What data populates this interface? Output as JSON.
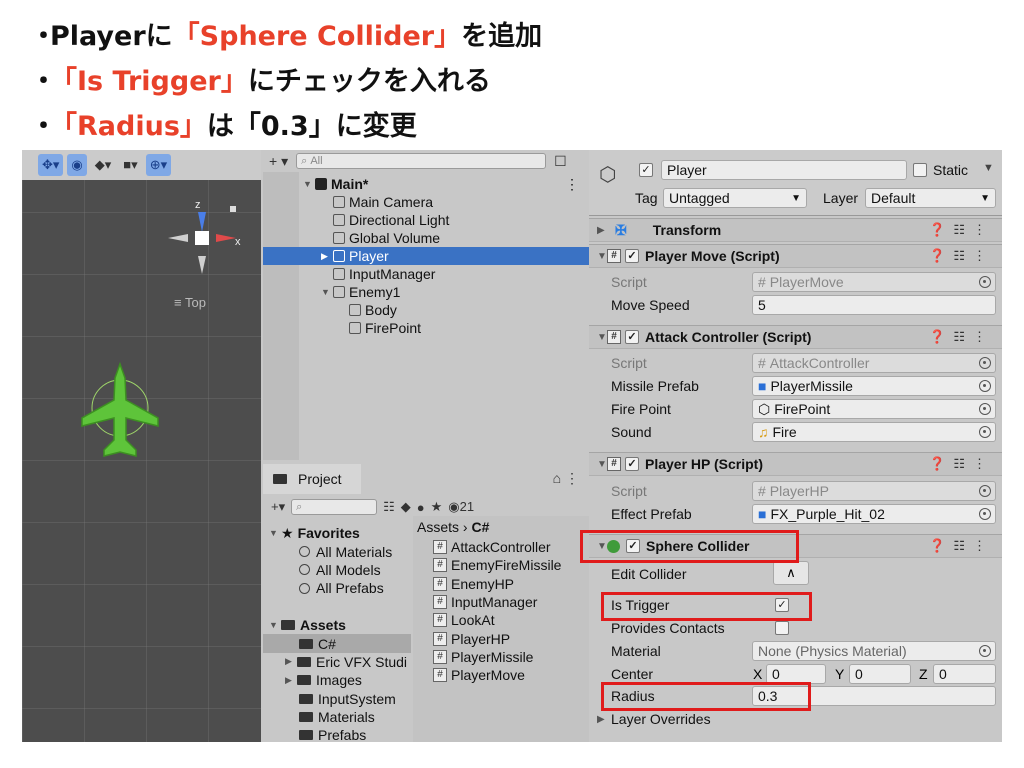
{
  "slide": {
    "bullets": [
      {
        "dot": "・",
        "pre": "Playerに",
        "red": "「Sphere Collider」",
        "post": "を追加"
      },
      {
        "dot": "・",
        "pre": "",
        "red": "「Is Trigger」",
        "post": "にチェックを入れる"
      },
      {
        "dot": "・",
        "pre": "",
        "red": "「Radius」",
        "post": "は「0.3」に変更"
      }
    ]
  },
  "scene": {
    "top_label": "≡ Top",
    "gizmo": {
      "z": "z",
      "x": "x"
    }
  },
  "hierarchy": {
    "add_label": "+ ▾",
    "search_placeholder": "All",
    "rows": [
      {
        "label": "Main*",
        "indent": 0
      },
      {
        "label": "Main Camera",
        "indent": 1
      },
      {
        "label": "Directional Light",
        "indent": 1
      },
      {
        "label": "Global Volume",
        "indent": 1
      },
      {
        "label": "Player",
        "indent": 1,
        "selected": true
      },
      {
        "label": "InputManager",
        "indent": 1
      },
      {
        "label": "Enemy1",
        "indent": 1
      },
      {
        "label": "Body",
        "indent": 2
      },
      {
        "label": "FirePoint",
        "indent": 2
      }
    ]
  },
  "project": {
    "tab": "Project",
    "count": "21",
    "tree": [
      {
        "label": "Favorites",
        "type": "star",
        "expand": "▼"
      },
      {
        "label": "All Materials",
        "type": "search"
      },
      {
        "label": "All Models",
        "type": "search"
      },
      {
        "label": "All Prefabs",
        "type": "search"
      },
      {
        "label": "",
        "type": "blank"
      },
      {
        "label": "Assets",
        "type": "folder",
        "expand": "▼"
      },
      {
        "label": "C#",
        "type": "folder",
        "selected": true
      },
      {
        "label": "Eric VFX Studi",
        "type": "folder",
        "expand": "▶"
      },
      {
        "label": "Images",
        "type": "folder",
        "expand": "▶"
      },
      {
        "label": "InputSystem",
        "type": "folder"
      },
      {
        "label": "Materials",
        "type": "folder"
      },
      {
        "label": "Prefabs",
        "type": "folder"
      }
    ],
    "breadcrumb": [
      "Assets",
      "C#"
    ],
    "files": [
      "AttackController",
      "EnemyFireMissile",
      "EnemyHP",
      "InputManager",
      "LookAt",
      "PlayerHP",
      "PlayerMissile",
      "PlayerMove"
    ]
  },
  "inspector": {
    "name": "Player",
    "static_label": "Static",
    "tag_label": "Tag",
    "tag_value": "Untagged",
    "layer_label": "Layer",
    "layer_value": "Default",
    "transform": "Transform",
    "player_move": {
      "title": "Player Move (Script)",
      "script_label": "Script",
      "script_value": "PlayerMove",
      "speed_label": "Move Speed",
      "speed_value": "5"
    },
    "attack": {
      "title": "Attack Controller (Script)",
      "script_label": "Script",
      "script_value": "AttackController",
      "missile_label": "Missile Prefab",
      "missile_value": "PlayerMissile",
      "fire_label": "Fire Point",
      "fire_value": "FirePoint",
      "sound_label": "Sound",
      "sound_value": "Fire"
    },
    "hp": {
      "title": "Player HP (Script)",
      "script_label": "Script",
      "script_value": "PlayerHP",
      "effect_label": "Effect Prefab",
      "effect_value": "FX_Purple_Hit_02"
    },
    "collider": {
      "title": "Sphere Collider",
      "edit_label": "Edit Collider",
      "trigger_label": "Is Trigger",
      "trigger_checked": "✓",
      "contacts_label": "Provides Contacts",
      "material_label": "Material",
      "material_value": "None (Physics Material)",
      "center_label": "Center",
      "center": {
        "x_label": "X",
        "x": "0",
        "y_label": "Y",
        "y": "0",
        "z_label": "Z",
        "z": "0"
      },
      "radius_label": "Radius",
      "radius_value": "0.3",
      "overrides_label": "Layer Overrides"
    }
  },
  "colors": {
    "accent_red": "#e8412a",
    "highlight_box": "#e01b1b",
    "selection_blue": "#3a72c4"
  }
}
